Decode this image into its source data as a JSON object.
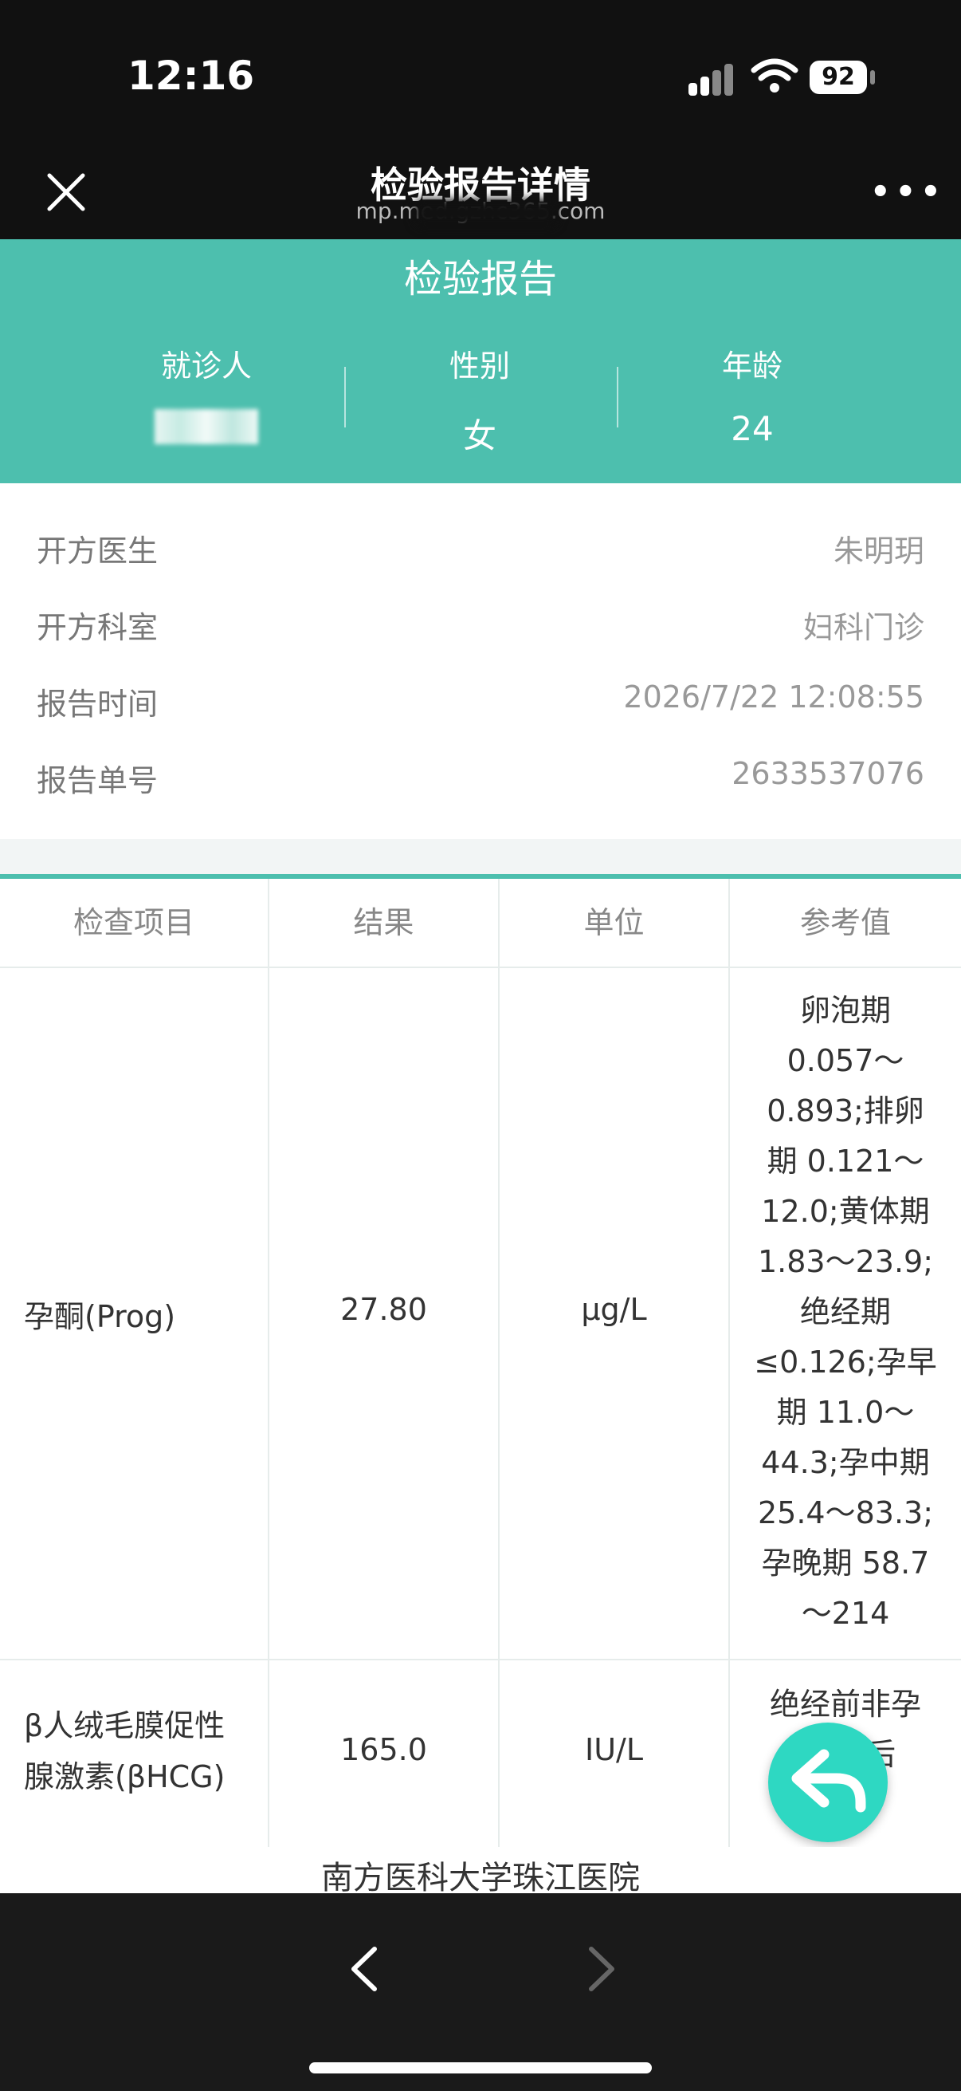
{
  "status": {
    "time": "12:16",
    "battery": "92"
  },
  "nav": {
    "title": "检验报告详情",
    "subtitle": "mp.med.gzhc365.com"
  },
  "report": {
    "title": "检验报告",
    "patient_label": "就诊人",
    "gender_label": "性别",
    "gender": "女",
    "age_label": "年龄",
    "age": "24"
  },
  "details": [
    {
      "key": "开方医生",
      "value": "朱明玥"
    },
    {
      "key": "开方科室",
      "value": "妇科门诊"
    },
    {
      "key": "报告时间",
      "value": "2026/7/22 12:08:55"
    },
    {
      "key": "报告单号",
      "value": "2633537076"
    }
  ],
  "table": {
    "headers": [
      "检查项目",
      "结果",
      "单位",
      "参考值"
    ],
    "rows": [
      {
        "item": "孕酮(Prog)",
        "result": "27.80",
        "unit": "μg/L",
        "ref_lines": [
          "卵泡期",
          "0.057～",
          "0.893;排卵",
          "期 0.121～",
          "12.0;黄体期",
          "1.83～23.9;",
          "绝经期",
          "≤0.126;孕早",
          "期 11.0～",
          "44.3;孕中期",
          "25.4～83.3;",
          "孕晚期 58.7",
          "～214"
        ]
      },
      {
        "item_lines": [
          "β人绒毛膜促性",
          "腺激素(βHCG)"
        ],
        "result": "165.0",
        "unit": "IU/L",
        "ref_lines": [
          "绝经前非孕",
          "期  经后"
        ]
      }
    ]
  },
  "footer": {
    "hospital": "南方医科大学珠江医院"
  },
  "colors": {
    "accent": "#4dbfae",
    "fab": "#2ed8c2"
  },
  "icons": {
    "close": "close-icon",
    "more": "more-icon",
    "back": "reply-arrow-icon",
    "nav_back": "chevron-left-icon",
    "nav_forward": "chevron-right-icon"
  }
}
